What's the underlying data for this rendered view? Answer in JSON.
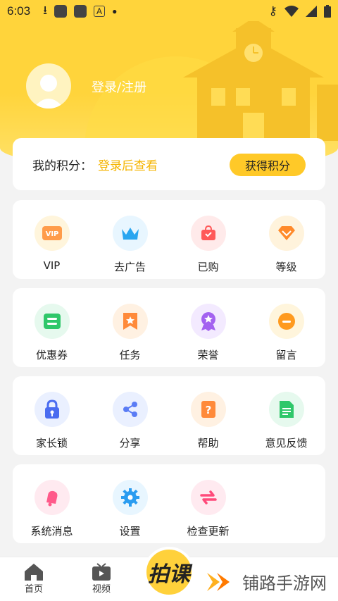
{
  "status_bar": {
    "time": "6:03"
  },
  "profile": {
    "login_label": "登录/注册"
  },
  "points": {
    "label": "我的积分：",
    "value": "登录后查看",
    "button": "获得积分"
  },
  "sections": [
    [
      {
        "label": "VIP",
        "icon": "vip-icon",
        "bg": "#fff5dc"
      },
      {
        "label": "去广告",
        "icon": "crown-icon",
        "bg": "#e8f6ff"
      },
      {
        "label": "已购",
        "icon": "bag-icon",
        "bg": "#ffeaea"
      },
      {
        "label": "等级",
        "icon": "diamond-icon",
        "bg": "#fff3dc"
      }
    ],
    [
      {
        "label": "优惠券",
        "icon": "coupon-icon",
        "bg": "#e6f9ee"
      },
      {
        "label": "任务",
        "icon": "bookmark-icon",
        "bg": "#fff1e2"
      },
      {
        "label": "荣誉",
        "icon": "medal-icon",
        "bg": "#f3eaff"
      },
      {
        "label": "留言",
        "icon": "message-icon",
        "bg": "#fff5dc"
      }
    ],
    [
      {
        "label": "家长锁",
        "icon": "lock-icon",
        "bg": "#eaf0ff"
      },
      {
        "label": "分享",
        "icon": "share-icon",
        "bg": "#eaf0ff"
      },
      {
        "label": "帮助",
        "icon": "help-icon",
        "bg": "#fff1e2"
      },
      {
        "label": "意见反馈",
        "icon": "feedback-icon",
        "bg": "#e6f9ee"
      }
    ],
    [
      {
        "label": "系统消息",
        "icon": "bell-icon",
        "bg": "#ffeaf0"
      },
      {
        "label": "设置",
        "icon": "gear-icon",
        "bg": "#e8f6ff"
      },
      {
        "label": "检查更新",
        "icon": "refresh-icon",
        "bg": "#ffeaf0"
      }
    ]
  ],
  "bottom_nav": {
    "home": "首页",
    "video": "视频",
    "center_logo": "拍课"
  },
  "watermark": "铺路手游网"
}
